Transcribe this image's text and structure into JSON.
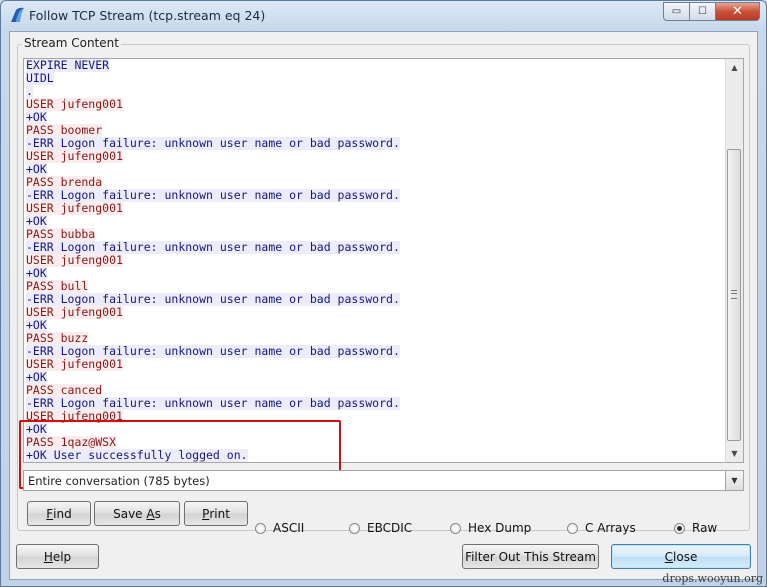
{
  "window": {
    "title": "Follow TCP Stream (tcp.stream eq 24)",
    "minimize_glyph": "▭",
    "maximize_glyph": "☐",
    "close_glyph": "✕"
  },
  "group": {
    "label": "Stream Content"
  },
  "stream": {
    "lines": [
      {
        "text": "EXPIRE NEVER",
        "dir": "server"
      },
      {
        "text": "UIDL",
        "dir": "server"
      },
      {
        "text": ".",
        "dir": "server"
      },
      {
        "text": "USER jufeng001",
        "dir": "client"
      },
      {
        "text": "+OK",
        "dir": "server"
      },
      {
        "text": "PASS boomer",
        "dir": "client"
      },
      {
        "text": "-ERR Logon failure: unknown user name or bad password.",
        "dir": "server"
      },
      {
        "text": "USER jufeng001",
        "dir": "client"
      },
      {
        "text": "+OK",
        "dir": "server"
      },
      {
        "text": "PASS brenda",
        "dir": "client"
      },
      {
        "text": "-ERR Logon failure: unknown user name or bad password.",
        "dir": "server"
      },
      {
        "text": "USER jufeng001",
        "dir": "client"
      },
      {
        "text": "+OK",
        "dir": "server"
      },
      {
        "text": "PASS bubba",
        "dir": "client"
      },
      {
        "text": "-ERR Logon failure: unknown user name or bad password.",
        "dir": "server"
      },
      {
        "text": "USER jufeng001",
        "dir": "client"
      },
      {
        "text": "+OK",
        "dir": "server"
      },
      {
        "text": "PASS bull",
        "dir": "client"
      },
      {
        "text": "-ERR Logon failure: unknown user name or bad password.",
        "dir": "server"
      },
      {
        "text": "USER jufeng001",
        "dir": "client"
      },
      {
        "text": "+OK",
        "dir": "server"
      },
      {
        "text": "PASS buzz",
        "dir": "client"
      },
      {
        "text": "-ERR Logon failure: unknown user name or bad password.",
        "dir": "server"
      },
      {
        "text": "USER jufeng001",
        "dir": "client"
      },
      {
        "text": "+OK",
        "dir": "server"
      },
      {
        "text": "PASS canced",
        "dir": "client"
      },
      {
        "text": "-ERR Logon failure: unknown user name or bad password.",
        "dir": "server"
      },
      {
        "text": "USER jufeng001",
        "dir": "client"
      },
      {
        "text": "+OK",
        "dir": "server"
      },
      {
        "text": "PASS 1qaz@WSX",
        "dir": "client"
      },
      {
        "text": "+OK User successfully logged on.",
        "dir": "server"
      }
    ],
    "client_color": "#8b1616",
    "server_color": "#17177f",
    "client_bg": "#fbeded",
    "server_bg": "#ececfb",
    "highlight_color": "#d01010"
  },
  "conversation_select": {
    "value": "Entire conversation (785 bytes)"
  },
  "buttons": {
    "find_mnemonic": "F",
    "find_rest": "ind",
    "save_as_pre": "Save ",
    "save_as_mnemonic": "A",
    "save_as_rest": "s",
    "print_mnemonic": "P",
    "print_rest": "rint",
    "help_mnemonic": "H",
    "help_rest": "elp",
    "filter_out": "Filter Out This Stream",
    "close_mnemonic": "C",
    "close_rest": "lose"
  },
  "format_options": [
    {
      "label": "ASCII",
      "checked": false
    },
    {
      "label": "EBCDIC",
      "checked": false
    },
    {
      "label": "Hex Dump",
      "checked": false
    },
    {
      "label": "C Arrays",
      "checked": false
    },
    {
      "label": "Raw",
      "checked": true
    }
  ],
  "watermark": "drops.wooyun.org"
}
